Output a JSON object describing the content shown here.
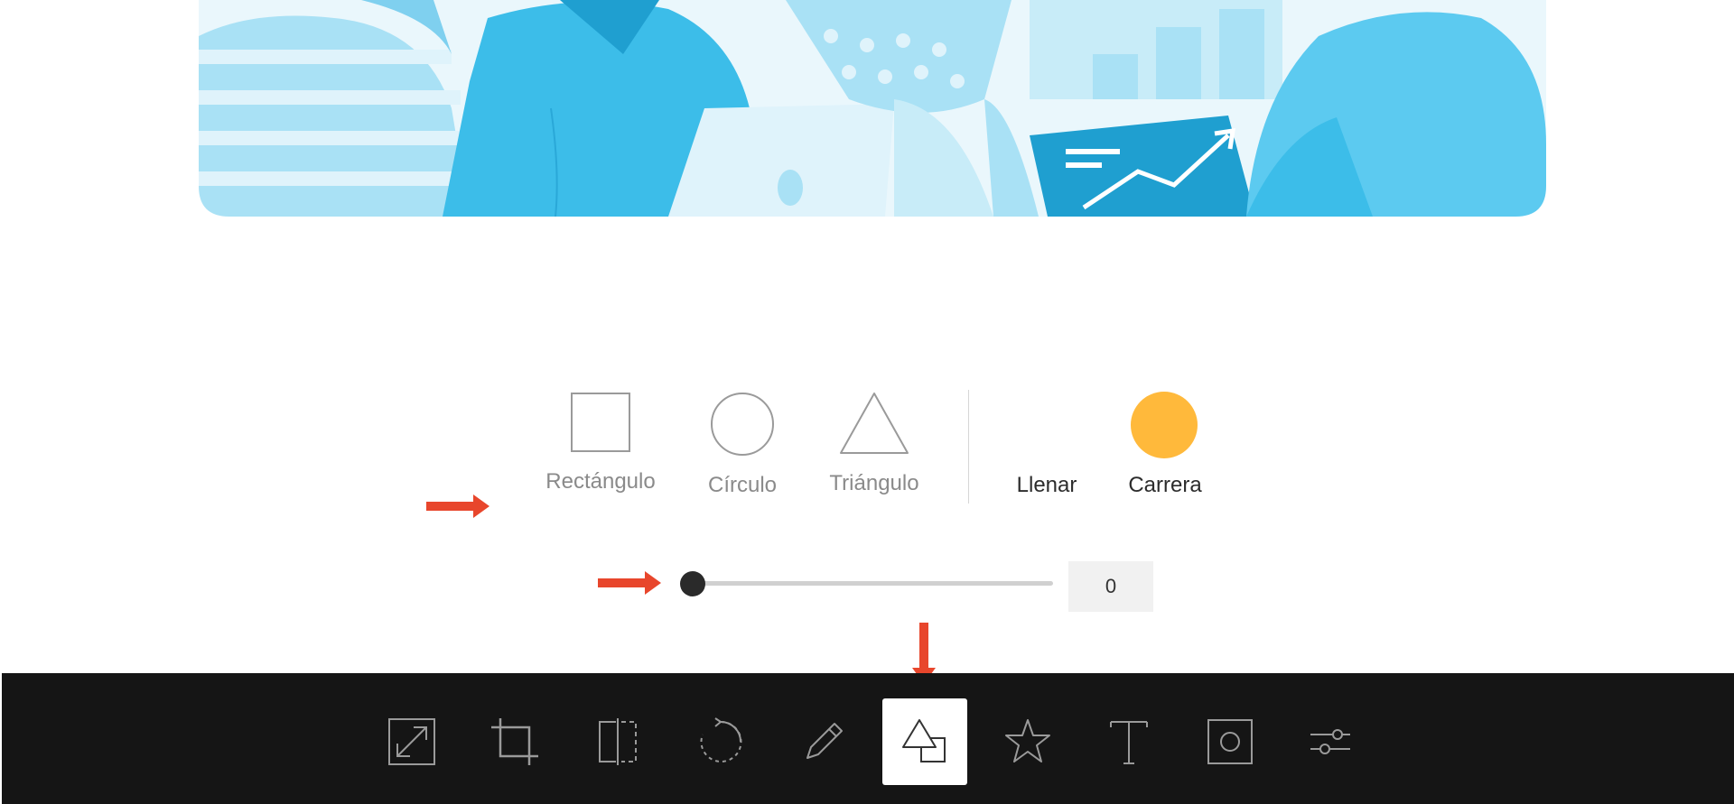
{
  "canvas": {
    "illustration": "people-working-illustration",
    "colors": {
      "primary": "#3cbde9",
      "light": "#a9e1f5",
      "pale": "#dff3fb",
      "dark": "#1f9fd0"
    }
  },
  "shapes_panel": {
    "shapes": [
      {
        "label": "Rectángulo",
        "icon": "rectangle-icon"
      },
      {
        "label": "Círculo",
        "icon": "circle-icon"
      },
      {
        "label": "Triángulo",
        "icon": "triangle-icon"
      }
    ],
    "fill_label": "Llenar",
    "stroke_label": "Carrera",
    "stroke_color": "#ffb93b"
  },
  "slider": {
    "value": "0",
    "min": 0,
    "max": 100,
    "level": 0
  },
  "annotations": {
    "arrow_color": "#e8462c"
  },
  "toolbar": {
    "active_tool": "shapes",
    "tools": [
      {
        "icon": "resize-icon"
      },
      {
        "icon": "crop-icon"
      },
      {
        "icon": "flip-icon"
      },
      {
        "icon": "rotate-icon"
      },
      {
        "icon": "draw-icon"
      },
      {
        "icon": "shapes-icon",
        "active": true
      },
      {
        "icon": "sticker-star-icon"
      },
      {
        "icon": "text-icon"
      },
      {
        "icon": "frame-icon"
      },
      {
        "icon": "adjust-icon"
      }
    ]
  }
}
